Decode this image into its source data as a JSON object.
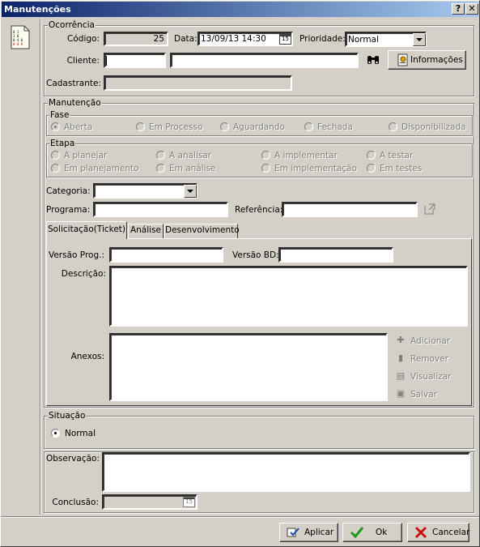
{
  "window": {
    "title": "Manutenções",
    "help_label": "?",
    "close_label": "✕"
  },
  "side_icon_name": "document-icon",
  "ocorrencia": {
    "group_label": "Ocorrência",
    "codigo_label": "Código:",
    "codigo_value": "25",
    "data_label": "Data:",
    "data_value": "13/09/13 14:30",
    "calendar_label": "15",
    "prioridade_label": "Prioridade:",
    "prioridade_value": "Normal",
    "cliente_label": "Cliente:",
    "cliente_code": "",
    "cliente_name": "",
    "informacoes_label": "Informações",
    "cadastrante_label": "Cadastrante:",
    "cadastrante_value": ""
  },
  "manutencao": {
    "group_label": "Manutenção",
    "fase": {
      "label": "Fase",
      "options": [
        "Aberta",
        "Em Processo",
        "Aguardando",
        "Fechada",
        "Disponibilizada"
      ],
      "selected": "Aberta"
    },
    "etapa": {
      "label": "Etapa",
      "row1": [
        "A planejar",
        "A analisar",
        "A implementar",
        "A testar"
      ],
      "row2": [
        "Em planejamento",
        "Em análise",
        "Em implementação",
        "Em testes"
      ]
    },
    "categoria_label": "Categoria:",
    "categoria_value": "",
    "programa_label": "Programa:",
    "programa_value": "",
    "referencia_label": "Referência:",
    "referencia_value": ""
  },
  "tabs": [
    "Solicitação(Ticket)",
    "Análise",
    "Desenvolvimento"
  ],
  "ticket": {
    "versao_prog_label": "Versão Prog.:",
    "versao_prog_value": "",
    "versao_bd_label": "Versão BD:",
    "versao_bd_value": "",
    "descricao_label": "Descrição:",
    "descricao_value": "",
    "anexos_label": "Anexos:",
    "anexo_actions": [
      "Adicionar",
      "Remover",
      "Visualizar",
      "Salvar"
    ]
  },
  "situacao": {
    "group_label": "Situação",
    "option": "Normal"
  },
  "observacao_label": "Observação:",
  "observacao_value": "",
  "conclusao_label": "Conclusão:",
  "conclusao_value": "",
  "buttons": {
    "aplicar": "Aplicar",
    "ok": "Ok",
    "cancelar": "Cancelar"
  },
  "colors": {
    "title_bar_start": "#0a246a",
    "title_bar_end": "#a6caf0",
    "window_face": "#d4d0c8",
    "ok_green": "#1a9a1a",
    "cancel_red": "#c81010"
  }
}
